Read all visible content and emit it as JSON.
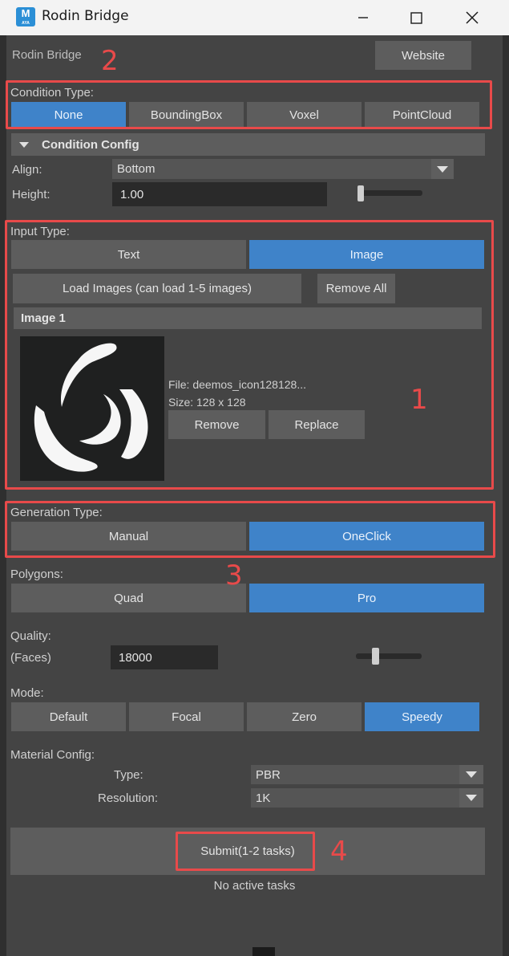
{
  "window": {
    "title": "Rodin Bridge",
    "icon_letter": "M",
    "icon_sub": "AYA"
  },
  "header": {
    "label": "Rodin Bridge",
    "website_button": "Website"
  },
  "condition": {
    "label": "Condition Type:",
    "options": [
      "None",
      "BoundingBox",
      "Voxel",
      "PointCloud"
    ],
    "selected": "None"
  },
  "condition_config": {
    "title": "Condition Config",
    "align_label": "Align:",
    "align_value": "Bottom",
    "height_label": "Height:",
    "height_value": "1.00",
    "height_slider_fraction": 0.0
  },
  "input": {
    "label": "Input Type:",
    "options": [
      "Text",
      "Image"
    ],
    "selected": "Image",
    "load_button": "Load Images (can load 1-5 images)",
    "remove_all_button": "Remove All",
    "image_section": "Image 1",
    "file_text": "File: deemos_icon128128...",
    "size_text": "Size: 128 x 128",
    "remove_button": "Remove",
    "replace_button": "Replace"
  },
  "generation": {
    "label": "Generation Type:",
    "options": [
      "Manual",
      "OneClick"
    ],
    "selected": "OneClick"
  },
  "polygons": {
    "label": "Polygons:",
    "options": [
      "Quad",
      "Pro"
    ],
    "selected": "Pro"
  },
  "quality": {
    "label": "Quality:",
    "sublabel": "(Faces)",
    "value": "18000"
  },
  "mode": {
    "label": "Mode:",
    "options": [
      "Default",
      "Focal",
      "Zero",
      "Speedy"
    ],
    "selected": "Speedy"
  },
  "material": {
    "label": "Material Config:",
    "type_label": "Type:",
    "type_value": "PBR",
    "resolution_label": "Resolution:",
    "resolution_value": "1K"
  },
  "submit": {
    "button": "Submit(1-2 tasks)",
    "status": "No active tasks"
  },
  "annotations": [
    "1",
    "2",
    "3",
    "4"
  ],
  "colors": {
    "selected": "#3f83c9",
    "highlight": "#e84a4a",
    "panel": "#444444"
  }
}
